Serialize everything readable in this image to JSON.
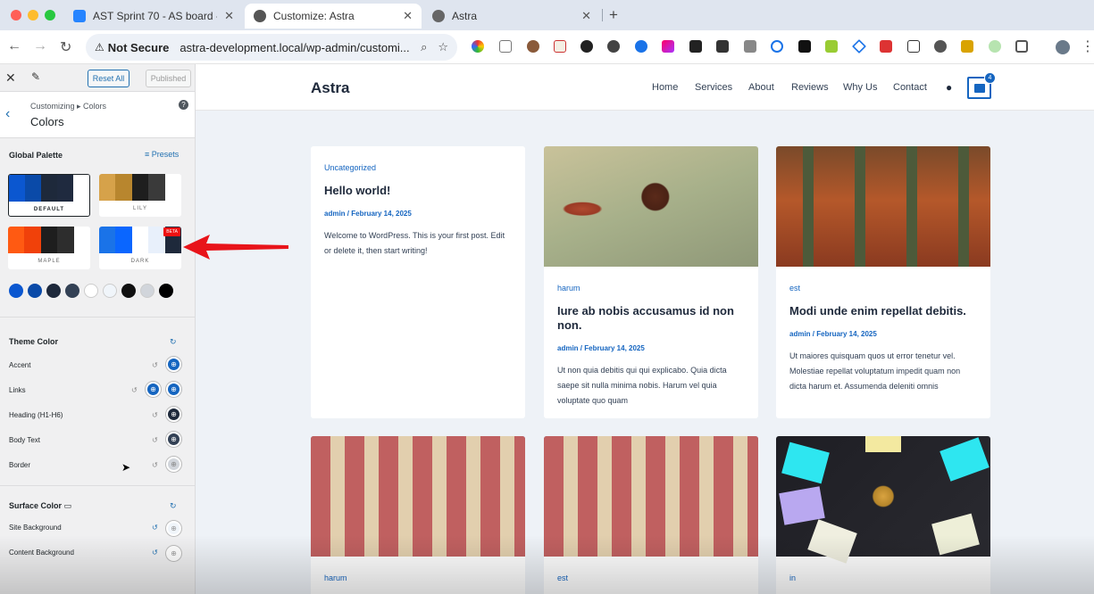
{
  "browser": {
    "tabs": [
      {
        "title": "AST Sprint 70 - AS board - Sc",
        "active": false
      },
      {
        "title": "Customize: Astra",
        "active": true
      },
      {
        "title": "Astra",
        "active": false
      }
    ],
    "security_label": "Not Secure",
    "url": "astra-development.local/wp-admin/customi..."
  },
  "sidebar": {
    "reset_label": "Reset All",
    "published_label": "Published",
    "breadcrumb": "Customizing ▸ Colors",
    "section_title": "Colors",
    "global_palette_title": "Global Palette",
    "presets_label": "Presets",
    "palettes": [
      {
        "name": "DEFAULT",
        "colors": [
          "#0b57d0",
          "#0a4aa8",
          "#1e293b",
          "#1f2a3f",
          "#ffffff"
        ],
        "selected": true
      },
      {
        "name": "LILY",
        "colors": [
          "#d6a24a",
          "#b8862e",
          "#1e1e1e",
          "#3a3a3a",
          "#ffffff"
        ],
        "selected": false
      },
      {
        "name": "MAPLE",
        "colors": [
          "#ff5a12",
          "#f0410a",
          "#1e1e1e",
          "#2d2d2d",
          "#ffffff"
        ],
        "selected": false
      },
      {
        "name": "DARK",
        "colors": [
          "#1a73e8",
          "#0a66ff",
          "#ffffff",
          "#e8f0fb",
          "#1e293b"
        ],
        "selected": false,
        "badge": "BETA"
      }
    ],
    "swatches": [
      "#0b57d0",
      "#0a4aa8",
      "#1e293b",
      "#334155",
      "#ffffff",
      "#f0f5fa",
      "#111111",
      "#d1d5db",
      "#000000"
    ],
    "theme_color_title": "Theme Color",
    "theme_rows": [
      {
        "label": "Accent",
        "color": "#1565c0"
      },
      {
        "label": "Links",
        "color": "#1565c0"
      },
      {
        "label": "Heading (H1-H6)",
        "color": "#1e293b"
      },
      {
        "label": "Body Text",
        "color": "#334155"
      },
      {
        "label": "Border",
        "color": "#d1d5db"
      }
    ],
    "surface_color_title": "Surface Color",
    "surface_rows": [
      {
        "label": "Site Background",
        "color": "#f0f5fa"
      },
      {
        "label": "Content Background",
        "color": "#ffffff"
      }
    ]
  },
  "site": {
    "logo": "Astra",
    "nav": [
      "Home",
      "Services",
      "About",
      "Reviews",
      "Why Us",
      "Contact"
    ],
    "cart_count": "4",
    "posts": [
      {
        "category": "Uncategorized",
        "title": "Hello world!",
        "meta": "admin / February 14, 2025",
        "excerpt": "Welcome to WordPress. This is your first post. Edit or delete it, then start writing!"
      },
      {
        "category": "harum",
        "title": "Iure ab nobis accusamus id non non.",
        "meta": "admin / February 14, 2025",
        "excerpt": "Ut non quia debitis qui qui explicabo. Quia dicta saepe sit nulla minima nobis. Harum vel quia voluptate quo quam"
      },
      {
        "category": "est",
        "title": "Modi unde enim repellat debitis.",
        "meta": "admin / February 14, 2025",
        "excerpt": "Ut maiores quisquam quos ut error tenetur vel. Molestiae repellat voluptatum impedit quam non dicta harum et. Assumenda deleniti omnis"
      },
      {
        "category": "harum"
      },
      {
        "category": "est"
      },
      {
        "category": "in"
      }
    ]
  },
  "colors": {
    "accent": "#1565c0",
    "annotation": "#e8141a"
  }
}
